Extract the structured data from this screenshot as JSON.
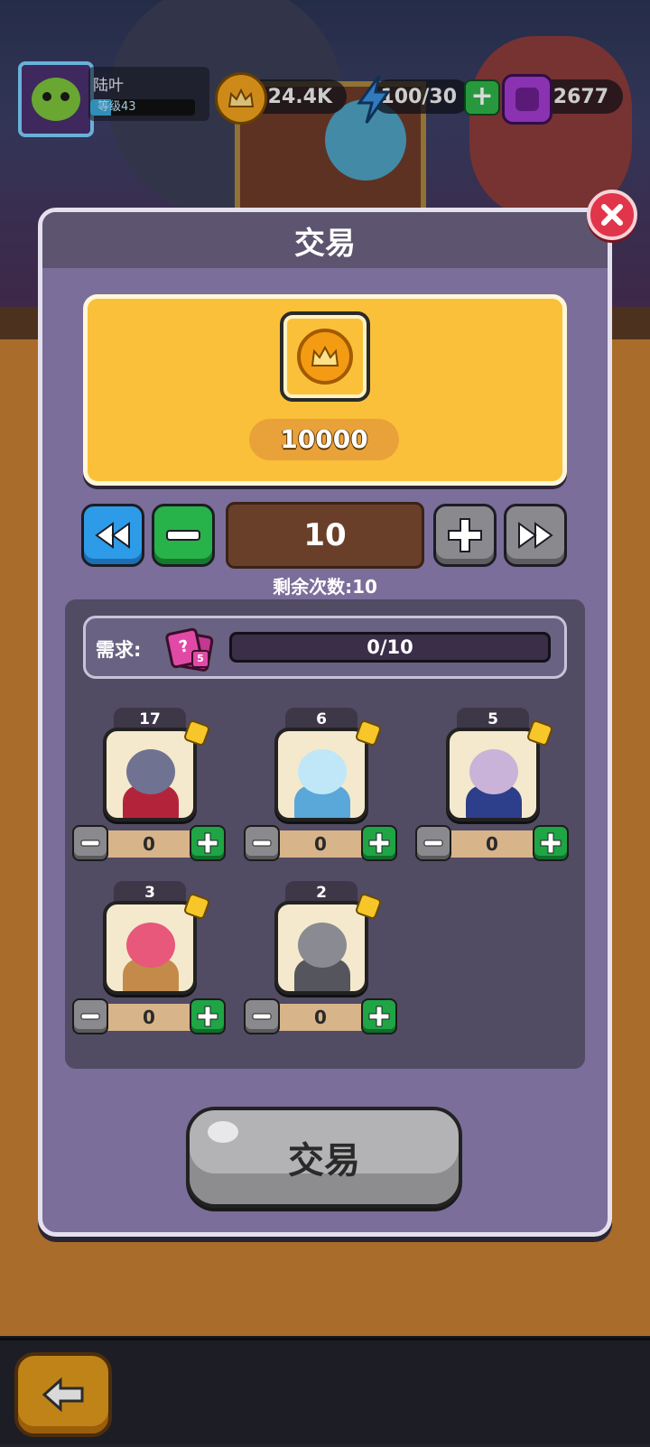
{
  "hud": {
    "player_name": "陆叶",
    "level_label": "等级43",
    "level_progress": 0.2,
    "coins": "24.4K",
    "energy": "100/30",
    "gems": "2677"
  },
  "modal": {
    "title": "交易",
    "reward_amount": "10000",
    "quantity": "10",
    "remaining_label": "剩余次数:10",
    "requirement_label": "需求:",
    "requirement_card_badge": "5",
    "requirement_progress": "0/10",
    "requirement_fraction": 0.0,
    "trade_button_label": "交易",
    "heroes": [
      {
        "name": "demon-hero",
        "count": "17",
        "selected": "0",
        "colors": {
          "head": "#6f7391",
          "body": "#b3243a"
        }
      },
      {
        "name": "ice-mage-hero",
        "count": "6",
        "selected": "0",
        "colors": {
          "head": "#bfe7f7",
          "body": "#5aa7d9"
        }
      },
      {
        "name": "samurai-hero",
        "count": "5",
        "selected": "0",
        "colors": {
          "head": "#c9b3d8",
          "body": "#2d3f8a"
        }
      },
      {
        "name": "spider-hero",
        "count": "3",
        "selected": "0",
        "colors": {
          "head": "#e7587a",
          "body": "#c48a4a"
        }
      },
      {
        "name": "ninja-hero",
        "count": "2",
        "selected": "0",
        "colors": {
          "head": "#8a8a92",
          "body": "#55555d"
        }
      }
    ]
  },
  "colors": {
    "accent_yellow": "#fbc03a",
    "modal_bg": "#7b6e9a",
    "close_red": "#e0354a",
    "plus_green": "#27b24a",
    "rewind_blue": "#2e9be8"
  }
}
